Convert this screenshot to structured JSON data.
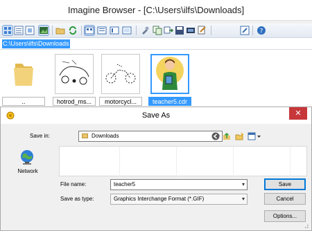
{
  "window": {
    "title": "Imagine Browser - [C:\\Users\\ilfs\\Downloads]"
  },
  "toolbar": {
    "buttons": [
      "thumbnail-view-icon",
      "list-view-icon",
      "details-view-icon",
      "image-view-icon",
      "open-folder-icon",
      "refresh-icon",
      "view-mode-1-icon",
      "view-mode-2-icon",
      "view-mode-3-icon",
      "view-mode-4-icon",
      "tools-icon",
      "copy-icon",
      "move-icon",
      "save-icon",
      "slideshow-icon",
      "batch-icon",
      "edit-icon",
      "help-icon"
    ]
  },
  "address": {
    "path": "C:\\Users\\ilfs\\Downloads"
  },
  "browser": {
    "items": [
      {
        "caption": "..",
        "icon": "parent-folder-icon"
      },
      {
        "caption": "hotrod_ms...",
        "icon": "hotrod-thumbnail"
      },
      {
        "caption": "motorcycl...",
        "icon": "motorcycle-thumbnail"
      },
      {
        "caption": "teacher5.cdr",
        "icon": "teacher-thumbnail",
        "selected": true
      }
    ]
  },
  "dialog": {
    "title": "Save As",
    "close_label": "✕",
    "save_in_label": "Save in:",
    "save_in_value": "Downloads",
    "places": {
      "network_label": "Network"
    },
    "file_name_label": "File name:",
    "file_name_value": "teacher5",
    "save_as_type_label": "Save as type:",
    "save_as_type_value": "Graphics Interchange Format (*.GIF)",
    "save_button": "Save",
    "cancel_button": "Cancel",
    "options_button": "Options..."
  },
  "colors": {
    "selection": "#3399ff",
    "close_button": "#c7383b",
    "dialog_body": "#f0f0f0",
    "default_button_border": "#0078d7"
  }
}
